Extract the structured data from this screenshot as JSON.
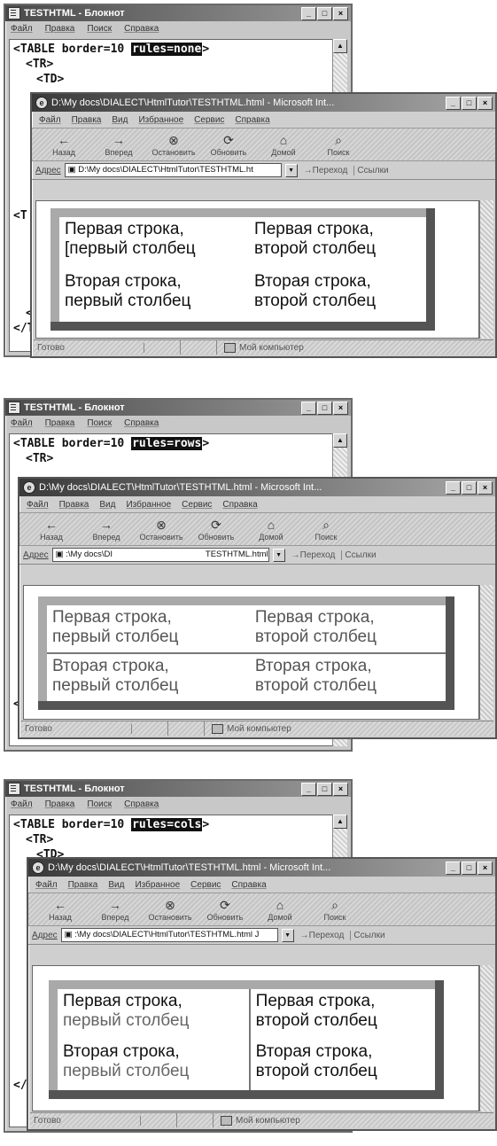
{
  "panels": [
    {
      "notepad": {
        "title": "TESTHTML - Блокнот",
        "menu": [
          "Файл",
          "Правка",
          "Поиск",
          "Справка"
        ],
        "line1_prefix": "<TABLE border=10 ",
        "line1_highlight": "rules=none",
        "line1_suffix": ">",
        "line2": "<TR>",
        "line3": "<TD>",
        "tail_a": "<T",
        "tail_b": "</",
        "tail_c": "</TA"
      },
      "browser": {
        "title": "D:\\My docs\\DIALECT\\HtmlTutor\\TESTHTML.html - Microsoft Int...",
        "address": "D:\\My docs\\DIALECT\\HtmlTutor\\TESTHTML.ht"
      },
      "table": {
        "rows": [
          [
            "Первая строка,",
            "Первая строка,"
          ],
          [
            "[первый столбец",
            "второй столбец"
          ],
          [
            "Вторая строка,",
            "Вторая строка,"
          ],
          [
            "первый столбец",
            "второй столбец"
          ]
        ]
      }
    },
    {
      "notepad": {
        "title": "TESTHTML - Блокнот",
        "menu": [
          "Файл",
          "Правка",
          "Поиск",
          "Справка"
        ],
        "line1_prefix": "<TABLE border=10 ",
        "line1_highlight": "rules=rows",
        "line1_suffix": ">",
        "line2": "<TR>",
        "line3": "",
        "tail_a": "",
        "tail_b": "<",
        "tail_c": ""
      },
      "browser": {
        "title": "D:\\My docs\\DIALECT\\HtmlTutor\\TESTHTML.html - Microsoft Int...",
        "address_a": ":\\My docs\\DI",
        "address_b": "TESTHTML.html"
      },
      "table": {
        "rows": [
          [
            "Первая строка,",
            "Первая строка,"
          ],
          [
            "первый столбец",
            "второй столбец"
          ],
          [
            "Вторая строка,",
            "Вторая строка,"
          ],
          [
            "первый столбец",
            "второй столбец"
          ]
        ]
      }
    },
    {
      "notepad": {
        "title": "TESTHTML - Блокнот",
        "menu": [
          "Файл",
          "Правка",
          "Поиск",
          "Справка"
        ],
        "line1_prefix": "<TABLE border=10 ",
        "line1_highlight": "rules=cols",
        "line1_suffix": ">",
        "line2": "<TR>",
        "line3": "<TD>",
        "tail_a": "",
        "tail_b": "</",
        "tail_c": ""
      },
      "browser": {
        "title": "D:\\My docs\\DIALECT\\HtmlTutor\\TESTHTML.html - Microsoft Int...",
        "address": ":\\My docs\\DIALECT\\HtmlTutor\\TESTHTML.html J"
      },
      "table": {
        "rows": [
          [
            "Первая строка,",
            "Первая строка,"
          ],
          [
            "первый столбец",
            "второй столбец"
          ],
          [
            "Вторая строка,",
            "Вторая строка,"
          ],
          [
            "первый столбец",
            "второй столбец"
          ]
        ]
      }
    }
  ],
  "ie_menu": [
    "Файл",
    "Правка",
    "Вид",
    "Избранное",
    "Сервис",
    "Справка"
  ],
  "ie_toolbar": {
    "back": "Назад",
    "forward": "Вперед",
    "stop": "Остановить",
    "refresh": "Обновить",
    "home": "Домой",
    "search": "Поиск"
  },
  "ie_address_label": "Адрес",
  "ie_go": "Переход",
  "ie_links": "Ссылки",
  "ie_status_ready": "Готово",
  "ie_status_zone": "Мой компьютер"
}
